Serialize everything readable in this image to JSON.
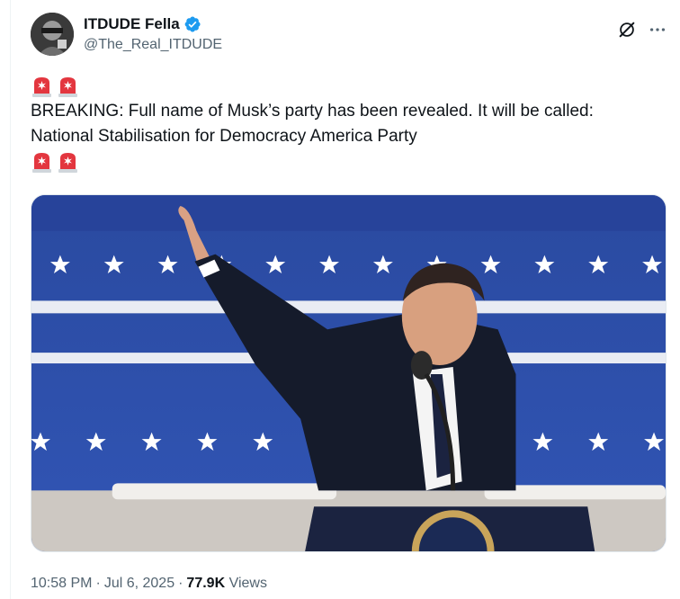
{
  "author": {
    "display_name": "ITDUDE Fella",
    "handle": "@The_Real_ITDUDE",
    "verified": true,
    "avatar_icon": "avatar-icon"
  },
  "tweet": {
    "emoji_top": [
      "rotating-light-emoji",
      "rotating-light-emoji"
    ],
    "line1": "BREAKING: Full name of Musk’s party has been revealed. It will be called:",
    "line2": "National Stabilisation for Democracy America Party",
    "emoji_bottom": [
      "rotating-light-emoji",
      "rotating-light-emoji"
    ]
  },
  "meta": {
    "time": "10:58 PM",
    "date": "Jul 6, 2025",
    "views_count": "77.9K",
    "views_label": "Views",
    "separator": "·"
  },
  "colors": {
    "accent_blue": "#1d9bf0",
    "secondary_text": "#536471",
    "primary_text": "#0f1419",
    "stage_blue": "#2b4fa8"
  },
  "icons": {
    "grok": "grok-icon",
    "more": "more-icon",
    "verified": "verified-badge-icon"
  }
}
